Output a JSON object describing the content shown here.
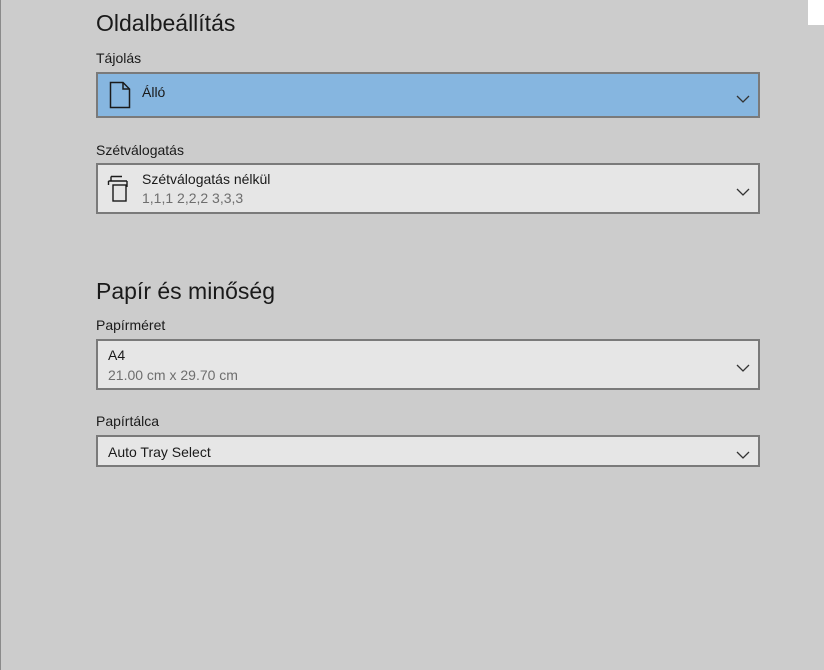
{
  "page_setup": {
    "title": "Oldalbeállítás",
    "orientation": {
      "label": "Tájolás",
      "value": "Álló",
      "icon": "portrait-page-icon"
    },
    "collation": {
      "label": "Szétválogatás",
      "value": "Szétválogatás nélkül",
      "detail": "1,1,1  2,2,2  3,3,3",
      "icon": "uncollated-pages-icon"
    }
  },
  "paper_quality": {
    "title": "Papír és minőség",
    "paper_size": {
      "label": "Papírméret",
      "value": "A4",
      "detail": "21.00 cm x 29.70 cm"
    },
    "paper_tray": {
      "label": "Papírtálca",
      "value": "Auto Tray Select"
    }
  },
  "colors": {
    "background": "#cccccc",
    "dropdown_bg": "#e6e6e6",
    "selected_bg": "#86b6e0",
    "border": "#7a7a7a"
  }
}
